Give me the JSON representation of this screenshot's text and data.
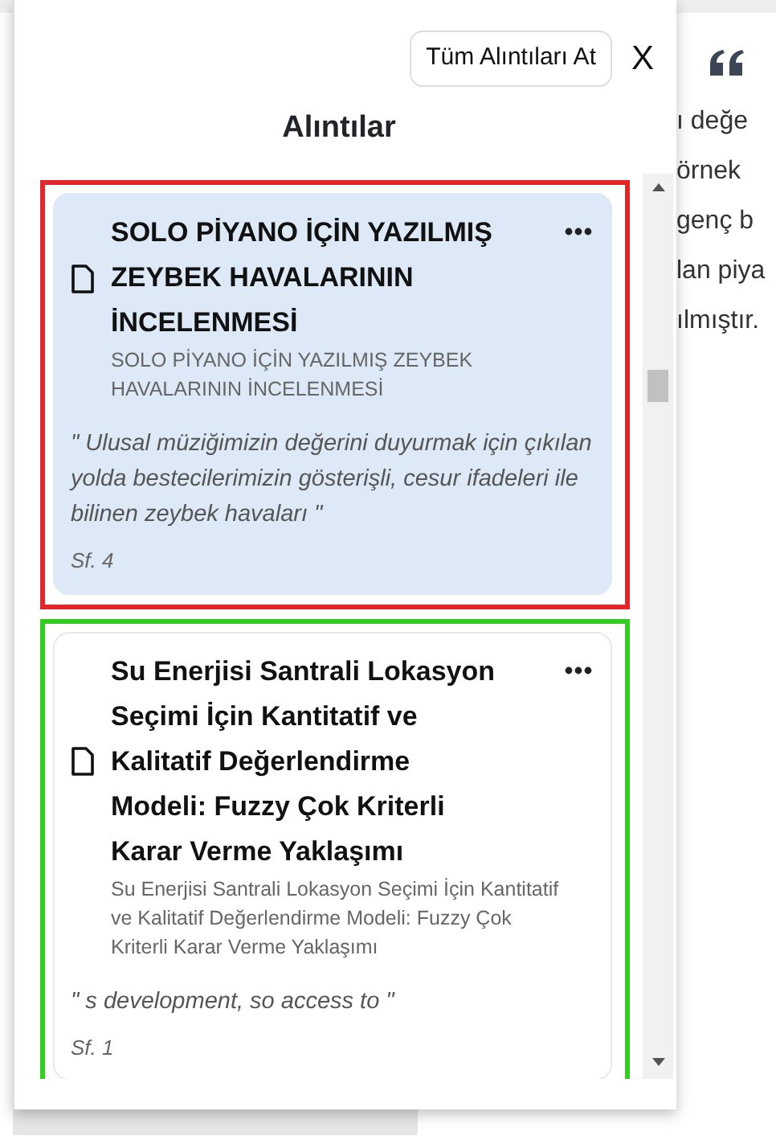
{
  "panel": {
    "clear_button": "Tüm Alıntıları At",
    "close": "X",
    "title": "Alıntılar"
  },
  "quotes": [
    {
      "title": "SOLO PİYANO İÇİN YAZILMIŞ ZEYBEK HAVALARININ İNCELENMESİ",
      "subtitle": "SOLO PİYANO İÇİN YAZILMIŞ ZEYBEK HAVALARININ İNCELENMESİ",
      "quote": "\" Ulusal müziğimizin değerini duyurmak için çıkılan yolda bestecilerimizin gösterişli, cesur ifadeleri ile bilinen zeybek havaları \"",
      "page": "Sf. 4",
      "selected": true,
      "color": "#e3262b"
    },
    {
      "title": "Su Enerjisi Santrali Lokasyon Seçimi İçin Kantitatif ve Kalitatif Değerlendirme Modeli: Fuzzy Çok Kriterli Karar Verme Yaklaşımı",
      "subtitle": "Su Enerjisi Santrali Lokasyon Seçimi İçin Kantitatif ve Kalitatif Değerlendirme Modeli: Fuzzy Çok Kriterli Karar Verme Yaklaşımı",
      "quote": "\" s development, so access to \"",
      "page": "Sf. 1",
      "selected": false,
      "color": "#33cc22"
    }
  ],
  "background_text": [
    "ı değe",
    "örnek",
    "genç b",
    "lan piya",
    "ılmıştır."
  ]
}
